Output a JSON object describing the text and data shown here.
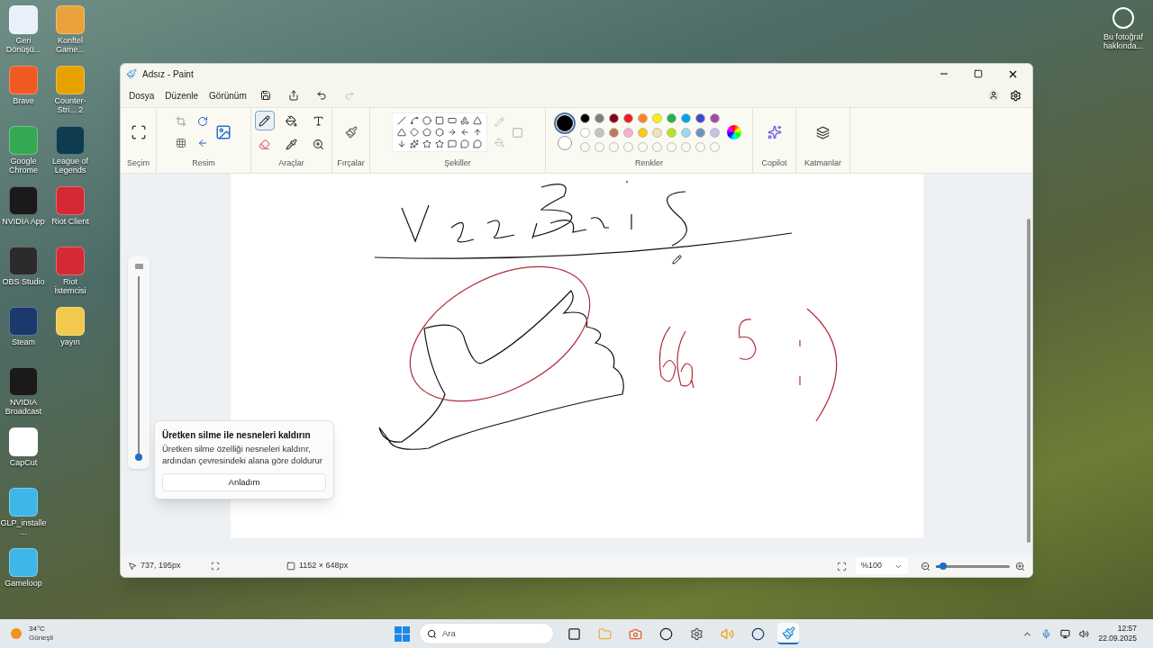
{
  "desktop": {
    "columns": [
      [
        "Geri Dönüşü...",
        "Brave",
        "Google Chrome",
        "NVIDIA App",
        "OBS Studio",
        "Steam",
        "NVIDIA Broadcast",
        "CapCut",
        "GLP_installe...",
        "Gameloop"
      ],
      [
        "Konftel Game...",
        "Counter-Stri... 2",
        "League of Legends",
        "Riot Client",
        "Riot İstemcisi",
        "yayın"
      ]
    ],
    "photo_info": "Bu fotoğraf hakkında..."
  },
  "window": {
    "title": "Adsız - Paint"
  },
  "menus": [
    "Dosya",
    "Düzenle",
    "Görünüm"
  ],
  "quick_actions": [
    {
      "kind": "save",
      "disabled": false
    },
    {
      "kind": "share",
      "disabled": false
    },
    {
      "kind": "undo",
      "disabled": false
    },
    {
      "kind": "redo",
      "disabled": true
    }
  ],
  "ribbon": {
    "groups": [
      "Seçim",
      "Resim",
      "Araçlar",
      "Fırçalar",
      "Şekiller",
      "Renkler",
      "Copilot",
      "Katmanlar"
    ],
    "tools": [
      {
        "kind": "pencil",
        "selected": true
      },
      {
        "kind": "fill",
        "selected": false
      },
      {
        "kind": "text",
        "selected": false
      },
      {
        "kind": "eraser",
        "selected": false
      },
      {
        "kind": "picker",
        "selected": false
      },
      {
        "kind": "zoom",
        "selected": false
      }
    ],
    "current_colors": [
      {
        "color": "#000000"
      },
      {
        "color": "#ffffff"
      }
    ],
    "palette": [
      {
        "color": "#000000"
      },
      {
        "color": "#7f7f7f"
      },
      {
        "color": "#880015"
      },
      {
        "color": "#ed1c24"
      },
      {
        "color": "#ff7f27"
      },
      {
        "color": "#fff200"
      },
      {
        "color": "#22b14c"
      },
      {
        "color": "#00a2e8"
      },
      {
        "color": "#3f48cc"
      },
      {
        "color": "#a349a4"
      },
      {
        "color": "#ffffff"
      },
      {
        "color": "#c3c3c3"
      },
      {
        "color": "#b97a57"
      },
      {
        "color": "#ffaec9"
      },
      {
        "color": "#ffc90e"
      },
      {
        "color": "#efe4b0"
      },
      {
        "color": "#b5e61d"
      },
      {
        "color": "#99d9ea"
      },
      {
        "color": "#7092be"
      },
      {
        "color": "#c8bfe7"
      }
    ]
  },
  "brush_size": {
    "level": 0
  },
  "tip": {
    "title": "Üretken silme ile nesneleri kaldırın",
    "body": "Üretken silme özelliği nesneleri kaldırır, ardından çevresindeki alana göre doldurur",
    "button": "Anladım"
  },
  "status_bar": {
    "cursor": "737, 195px",
    "size": "1152 × 648px",
    "zoom": "%100",
    "zoom_level": {
      "level": 0.1
    }
  },
  "taskbar": {
    "temperature": "34°C",
    "weather": "Güneşli",
    "search_placeholder": "Ara",
    "apps": [
      {
        "kind": "taskview",
        "selected": false
      },
      {
        "kind": "folder",
        "selected": false
      },
      {
        "kind": "brave",
        "selected": false
      },
      {
        "kind": "obs",
        "selected": false
      },
      {
        "kind": "settings",
        "selected": false
      },
      {
        "kind": "konftel",
        "selected": false
      },
      {
        "kind": "steam",
        "selected": false
      },
      {
        "kind": "paint",
        "selected": true
      }
    ],
    "time": "12:57",
    "date": "22.09.2025"
  }
}
